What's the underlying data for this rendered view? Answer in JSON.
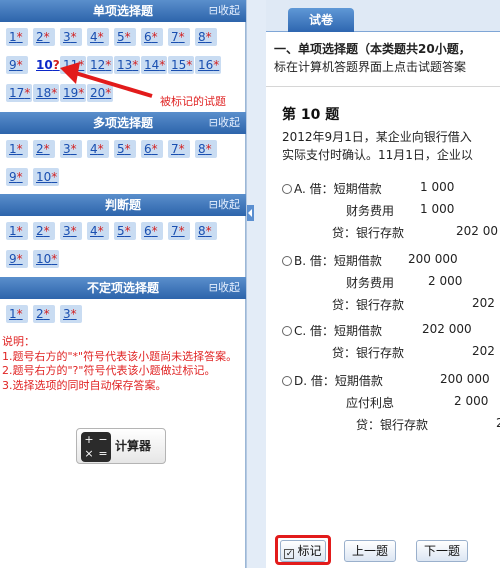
{
  "sidebar": {
    "collapse_label": "⊟收起",
    "sections": [
      {
        "title": "单项选择题",
        "rows": [
          [
            "1",
            "2",
            "3",
            "4",
            "5",
            "6",
            "7",
            "8"
          ],
          [
            "9",
            "10",
            "11",
            "12",
            "13",
            "14",
            "15",
            "16"
          ],
          [
            "17",
            "18",
            "19",
            "20"
          ]
        ]
      },
      {
        "title": "多项选择题",
        "rows": [
          [
            "1",
            "2",
            "3",
            "4",
            "5",
            "6",
            "7",
            "8"
          ],
          [
            "9",
            "10"
          ]
        ]
      },
      {
        "title": "判断题",
        "rows": [
          [
            "1",
            "2",
            "3",
            "4",
            "5",
            "6",
            "7",
            "8"
          ],
          [
            "9",
            "10"
          ]
        ]
      },
      {
        "title": "不定项选择题",
        "rows": [
          [
            "1",
            "2",
            "3"
          ]
        ]
      }
    ],
    "marked_question": "10",
    "unanswered_symbol": "*",
    "marked_symbol": "?",
    "annotation": "被标记的试题",
    "notes": {
      "title": "说明：",
      "items": [
        "1.题号右方的\"*\"符号代表该小题尚未选择答案。",
        "2.题号右方的\"?\"符号代表该小题做过标记。",
        "3.选择选项的同时自动保存答案。"
      ]
    },
    "calculator_label": "计算器"
  },
  "exam": {
    "tab_label": "试卷",
    "intro_line1": "一、单项选择题（本类题共20小题，",
    "intro_line2": "标在计算机答题界面上点击试题答案",
    "question_title": "第 10 题",
    "stem_line1": "2012年9月1日，某企业向银行借入",
    "stem_line2": "实际支付时确认。11月1日，企业以",
    "options": [
      {
        "key": "A.",
        "lines": [
          {
            "acct": "借：短期借款",
            "amt": "1 000"
          },
          {
            "acct": "财务费用",
            "amt": "1 000"
          },
          {
            "acct": "贷：银行存款",
            "amt": "202 00"
          }
        ]
      },
      {
        "key": "B.",
        "lines": [
          {
            "acct": "借：短期借款",
            "amt": "200 000"
          },
          {
            "acct": "财务费用",
            "amt": "2 000"
          },
          {
            "acct": "贷：银行存款",
            "amt": "202"
          }
        ]
      },
      {
        "key": "C.",
        "lines": [
          {
            "acct": "借：短期借款",
            "amt": "202 000"
          },
          {
            "acct": "贷：银行存款",
            "amt": "202"
          }
        ]
      },
      {
        "key": "D.",
        "lines": [
          {
            "acct": "借：短期借款",
            "amt": "200 000"
          },
          {
            "acct": "应付利息",
            "amt": "2 000"
          },
          {
            "acct": "贷：银行存款",
            "amt": "2"
          }
        ]
      }
    ],
    "mark_label": "标记",
    "prev_label": "上一题",
    "next_label": "下一题"
  },
  "colors": {
    "header_blue": "#2d64ab",
    "cell_blue": "#c9dcf2",
    "note_red": "#e02424",
    "highlight_red": "#e21b1b"
  }
}
